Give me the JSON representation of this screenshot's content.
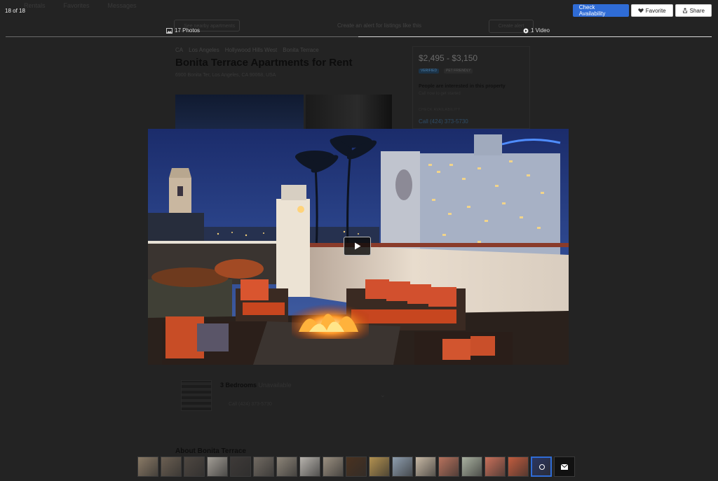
{
  "background_page": {
    "nav": [
      "Rentals",
      "Favorites",
      "Messages"
    ],
    "see_nearby": "See nearby apartments",
    "alert_text": "Create an alert for listings like this",
    "alert_button": "Create alert",
    "breadcrumbs": [
      "CA",
      "Los Angeles",
      "Hollywood Hills West",
      "Bonita Terrace"
    ],
    "title": "Bonita Terrace Apartments for Rent",
    "address": "6900 Bonita Ter, Los Angeles, CA 90068, USA",
    "price": "$2,495 - $3,150",
    "badges": [
      "VERIFIED",
      "PET FRIENDLY"
    ],
    "interest_title": "People are interested in this property",
    "interest_sub": "Call now to get started",
    "check_label": "CHECK AVAILABILITY",
    "phone": "Call (424) 373-5730",
    "floorplan_beds": "3 Bedrooms",
    "floorplan_status": "Unavailable",
    "floorplan_call": "Call (424) 373-5730",
    "about": "About Bonita Terrace"
  },
  "gallery": {
    "counter": "18 of 18",
    "check_availability": "Check Availability",
    "favorite": "Favorite",
    "share": "Share",
    "photos_tab": "17 Photos",
    "video_tab": "1 Video"
  },
  "colors": {
    "accent": "#2f6cd6",
    "overlay": "#232323"
  },
  "icons": [
    "photo-icon",
    "video-icon",
    "heart-icon",
    "share-icon",
    "play-icon",
    "mail-icon"
  ],
  "thumbnails": [
    {
      "bg": "#8a7a66"
    },
    {
      "bg": "#6b5f52"
    },
    {
      "bg": "#4e4741"
    },
    {
      "bg": "#a29d95"
    },
    {
      "bg": "#3e3a38"
    },
    {
      "bg": "#716a62"
    },
    {
      "bg": "#8c8478"
    },
    {
      "bg": "#b7b3ad"
    },
    {
      "bg": "#9a8f80"
    },
    {
      "bg": "#4a3220"
    },
    {
      "bg": "#b29150"
    },
    {
      "bg": "#8e9eae"
    },
    {
      "bg": "#c7b8a4"
    },
    {
      "bg": "#b7725d"
    },
    {
      "bg": "#a9b1a0"
    },
    {
      "bg": "#c9705a"
    },
    {
      "bg": "#c25c3e"
    },
    {
      "bg": "#2a3560",
      "active": true,
      "video": true
    },
    {
      "bg": "#111111",
      "mail": true
    }
  ]
}
